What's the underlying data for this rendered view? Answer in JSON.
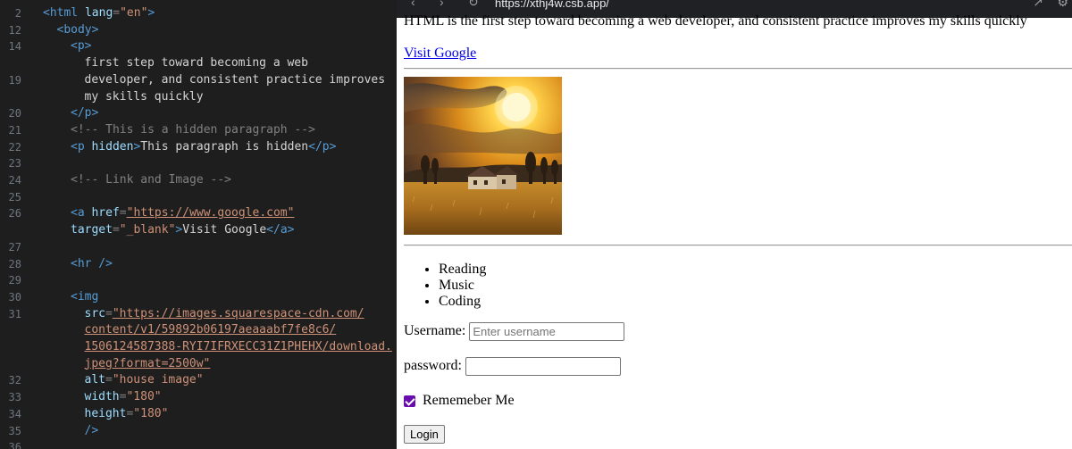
{
  "editor": {
    "lines": [
      {
        "num": "2",
        "parts": [
          [
            "tag",
            "<html "
          ],
          [
            "attr",
            "lang"
          ],
          [
            "punc",
            "="
          ],
          [
            "str",
            "\"en\""
          ],
          [
            "tag",
            ">"
          ]
        ],
        "indent": 0
      },
      {
        "num": "12",
        "parts": [
          [
            "tag",
            "<body>"
          ]
        ],
        "indent": 1
      },
      {
        "num": "14",
        "parts": [
          [
            "tag",
            "<p>"
          ]
        ],
        "indent": 2
      },
      {
        "num": "",
        "parts": [
          [
            "text",
            "first step toward becoming a web"
          ]
        ],
        "indent": 3
      },
      {
        "num": "19",
        "parts": [
          [
            "text",
            "developer, and consistent practice improves"
          ]
        ],
        "indent": 3
      },
      {
        "num": "",
        "parts": [
          [
            "text",
            "my skills quickly"
          ]
        ],
        "indent": 3
      },
      {
        "num": "20",
        "parts": [
          [
            "tag",
            "</p>"
          ]
        ],
        "indent": 2
      },
      {
        "num": "21",
        "parts": [
          [
            "muted",
            "<!-- This is a hidden paragraph -->"
          ]
        ],
        "indent": 2
      },
      {
        "num": "22",
        "parts": [
          [
            "tag",
            "<p "
          ],
          [
            "attr",
            "hidden"
          ],
          [
            "tag",
            ">"
          ],
          [
            "text",
            "This paragraph is hidden"
          ],
          [
            "tag",
            "</p>"
          ]
        ],
        "indent": 2
      },
      {
        "num": "23",
        "parts": [],
        "indent": 0
      },
      {
        "num": "24",
        "parts": [
          [
            "muted",
            "<!-- Link and Image -->"
          ]
        ],
        "indent": 2
      },
      {
        "num": "25",
        "parts": [],
        "indent": 0
      },
      {
        "num": "26",
        "parts": [
          [
            "tag",
            "<a "
          ],
          [
            "attr",
            "href"
          ],
          [
            "punc",
            "="
          ],
          [
            "url",
            "\"https://www.google.com\""
          ]
        ],
        "indent": 2
      },
      {
        "num": "",
        "parts": [
          [
            "attr",
            "target"
          ],
          [
            "punc",
            "="
          ],
          [
            "str",
            "\"_blank\""
          ],
          [
            "tag",
            ">"
          ],
          [
            "text",
            "Visit Google"
          ],
          [
            "tag",
            "</a>"
          ]
        ],
        "indent": 2
      },
      {
        "num": "27",
        "parts": [],
        "indent": 0
      },
      {
        "num": "28",
        "parts": [
          [
            "tag",
            "<hr />"
          ]
        ],
        "indent": 2
      },
      {
        "num": "29",
        "parts": [],
        "indent": 0
      },
      {
        "num": "30",
        "parts": [
          [
            "tag",
            "<img"
          ]
        ],
        "indent": 2
      },
      {
        "num": "31",
        "parts": [
          [
            "attr",
            "src"
          ],
          [
            "punc",
            "="
          ],
          [
            "url",
            "\"https://images.squarespace-cdn.com/"
          ]
        ],
        "indent": 3
      },
      {
        "num": "",
        "parts": [
          [
            "url",
            "content/v1/59892b06197aeaaabf7fe8c6/"
          ]
        ],
        "indent": 3
      },
      {
        "num": "",
        "parts": [
          [
            "url",
            "1506124587388-RYI7IFRXECC31Z1PHEHX/download."
          ]
        ],
        "indent": 3
      },
      {
        "num": "",
        "parts": [
          [
            "url",
            "jpeg?format=2500w\""
          ]
        ],
        "indent": 3
      },
      {
        "num": "32",
        "parts": [
          [
            "attr",
            "alt"
          ],
          [
            "punc",
            "="
          ],
          [
            "str",
            "\"house image\""
          ]
        ],
        "indent": 3
      },
      {
        "num": "33",
        "parts": [
          [
            "attr",
            "width"
          ],
          [
            "punc",
            "="
          ],
          [
            "str",
            "\"180\""
          ]
        ],
        "indent": 3
      },
      {
        "num": "34",
        "parts": [
          [
            "attr",
            "height"
          ],
          [
            "punc",
            "="
          ],
          [
            "str",
            "\"180\""
          ]
        ],
        "indent": 3
      },
      {
        "num": "35",
        "parts": [
          [
            "tag",
            "/>"
          ]
        ],
        "indent": 3
      },
      {
        "num": "36",
        "parts": [],
        "indent": 0
      }
    ]
  },
  "browser": {
    "address": "https://xthj4w.csb.app/",
    "paragraph": "HTML is the first step toward becoming a web developer, and consistent practice improves my skills quickly",
    "link_label": "Visit Google",
    "hobbies": [
      "Reading",
      "Music",
      "Coding"
    ],
    "username_label": "Username:",
    "username_placeholder": "Enter username",
    "password_label": "password:",
    "remember_label": "Rememeber Me",
    "login_label": "Login"
  }
}
